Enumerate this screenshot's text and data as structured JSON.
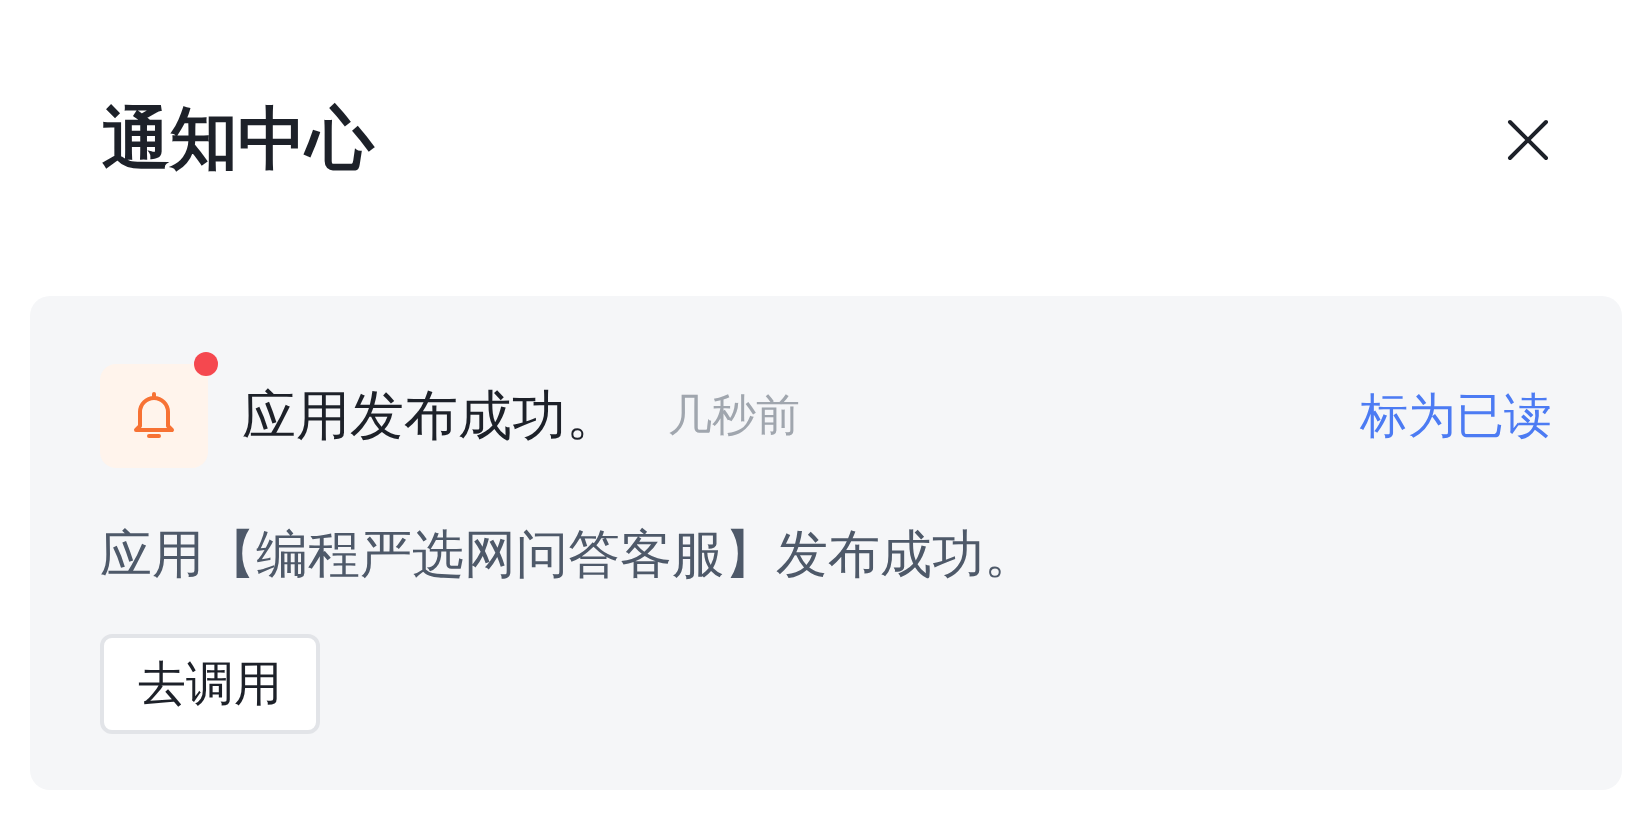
{
  "panel": {
    "title": "通知中心"
  },
  "notifications": [
    {
      "title": "应用发布成功。",
      "time": "几秒前",
      "mark_read": "标为已读",
      "unread": true,
      "body": "应用【编程严选网问答客服】发布成功。",
      "action": "去调用"
    }
  ]
}
